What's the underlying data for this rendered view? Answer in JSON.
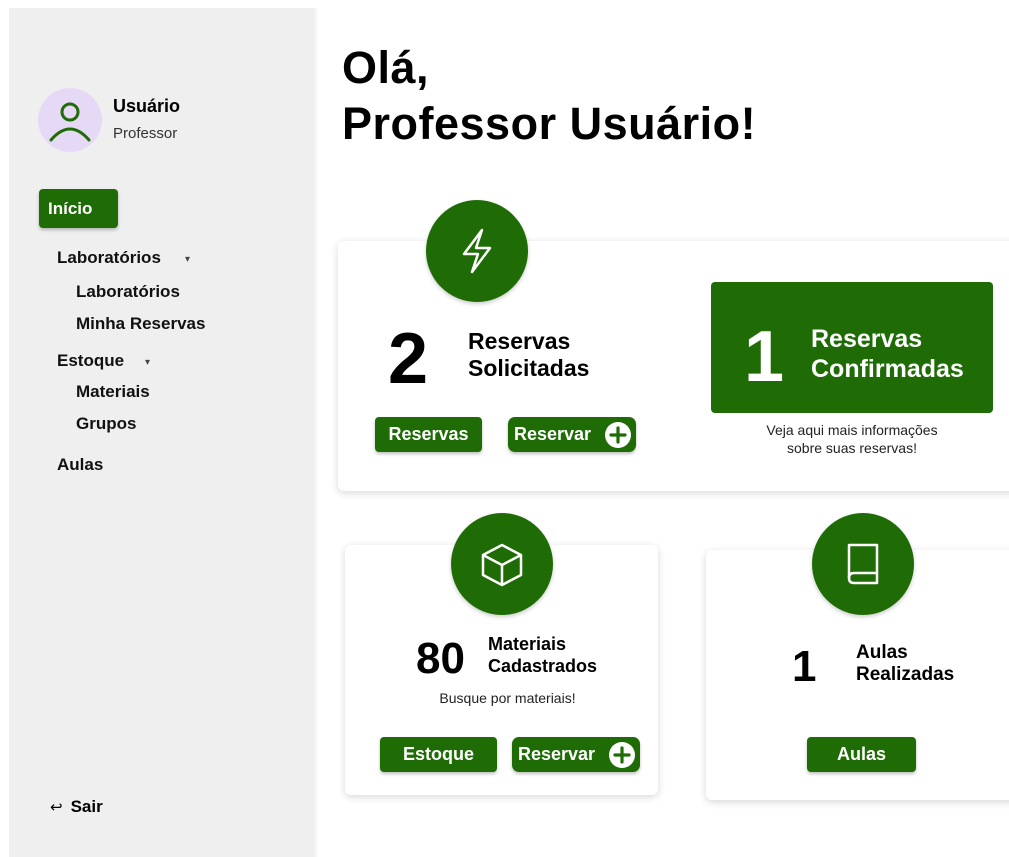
{
  "sidebar": {
    "user_name": "Usuário",
    "user_role": "Professor",
    "avatar_icon": "user-icon",
    "nav": {
      "inicio": "Início",
      "laboratorios": "Laboratórios",
      "laboratorios_sub": "Laboratórios",
      "minha_reservas": "Minha Reservas",
      "estoque": "Estoque",
      "materiais": "Materiais",
      "grupos": "Grupos",
      "aulas": "Aulas"
    },
    "logout": "Sair",
    "logout_icon": "return-arrow-icon"
  },
  "greeting": {
    "line1": "Olá,",
    "line2": "Professor Usuário!"
  },
  "reservas_card": {
    "icon": "lightning-icon",
    "count": "2",
    "label_line1": "Reservas",
    "label_line2": "Solicitadas",
    "btn_reservas": "Reservas",
    "btn_reservar": "Reservar",
    "confirmed_count": "1",
    "confirmed_line1": "Reservas",
    "confirmed_line2": "Confirmadas",
    "info_line1": "Veja aqui mais informações",
    "info_line2": "sobre suas reservas!"
  },
  "materiais_card": {
    "icon": "box-icon",
    "count": "80",
    "label_line1": "Materiais",
    "label_line2": "Cadastrados",
    "sub": "Busque por materiais!",
    "btn_estoque": "Estoque",
    "btn_reservar": "Reservar"
  },
  "aulas_card": {
    "icon": "book-icon",
    "count": "1",
    "label_line1": "Aulas",
    "label_line2": "Realizadas",
    "btn_aulas": "Aulas"
  },
  "colors": {
    "primary": "#1f6c06",
    "sidebar_bg": "#efefef",
    "avatar_bg": "#e6d9f6"
  }
}
